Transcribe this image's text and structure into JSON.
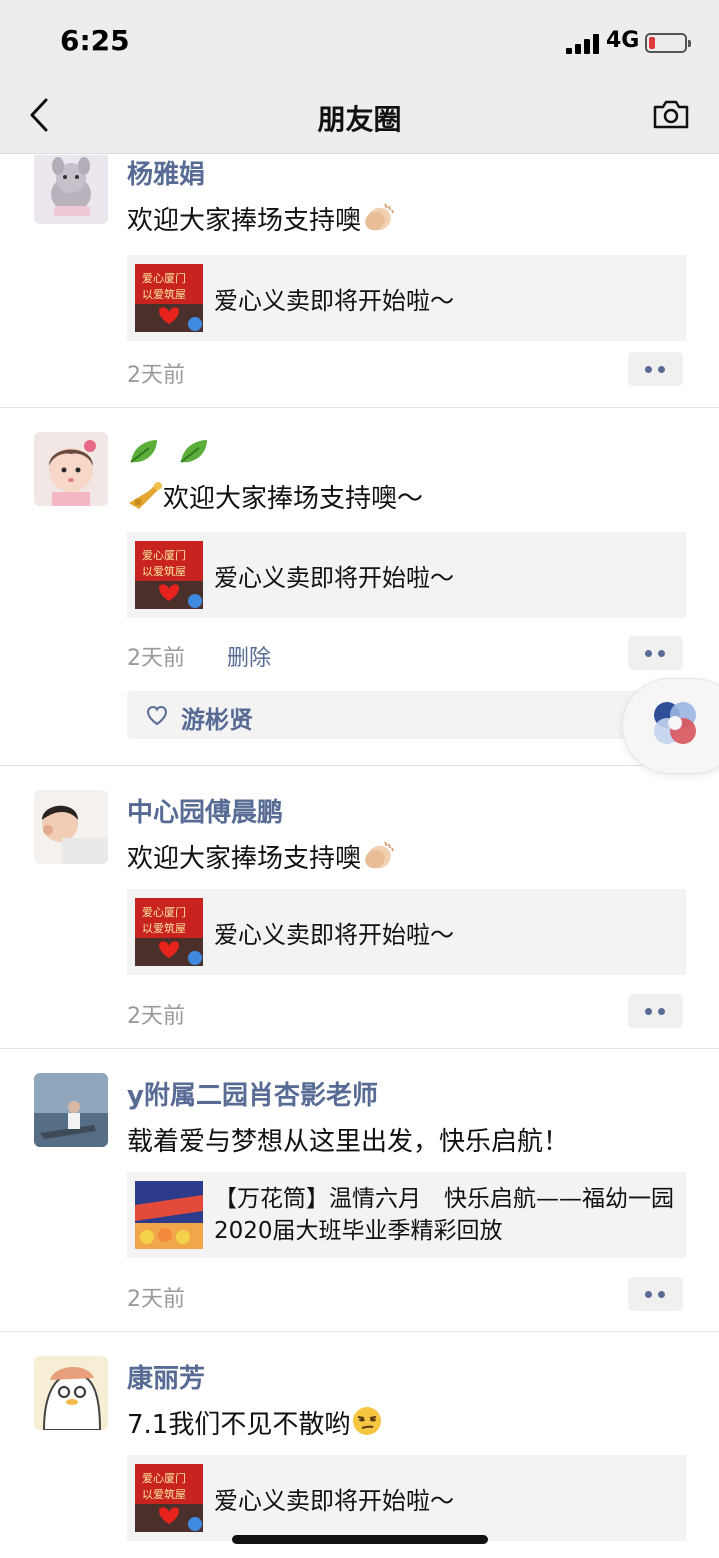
{
  "status_bar": {
    "time": "6:25",
    "network": "4G"
  },
  "nav": {
    "title": "朋友圈",
    "back_icon": "chevron-left-icon",
    "camera_icon": "camera-icon"
  },
  "posts": [
    {
      "author": "杨雅娟",
      "text": "欢迎大家捧场支持噢",
      "text_emoji": "clapping-hands-emoji",
      "card": {
        "title": "爱心义卖即将开始啦～",
        "thumb_text": "爱心厦门 以爱筑屋"
      },
      "time": "2天前"
    },
    {
      "emoji_line": "leaf-emoji leaf-emoji",
      "text": "欢迎大家捧场支持噢～",
      "text_emoji": "trumpet-emoji",
      "card": {
        "title": "爱心义卖即将开始啦～",
        "thumb_text": "爱心厦门 以爱筑屋"
      },
      "time": "2天前",
      "delete_label": "删除",
      "liker": "游彬贤"
    },
    {
      "author": "中心园傅晨鹏",
      "text": "欢迎大家捧场支持噢",
      "text_emoji": "clapping-hands-emoji",
      "card": {
        "title": "爱心义卖即将开始啦～",
        "thumb_text": "爱心厦门 以爱筑屋"
      },
      "time": "2天前"
    },
    {
      "author": "y附属二园肖杏影老师",
      "text": "载着爱与梦想从这里出发，快乐启航！",
      "card": {
        "title": "【万花筒】温情六月　快乐启航——福幼一园2020届大班毕业季精彩回放"
      },
      "time": "2天前"
    },
    {
      "author": "康丽芳",
      "text": "7.1我们不见不散哟",
      "text_emoji": "smirk-emoji",
      "card": {
        "title": "爱心义卖即将开始啦～",
        "thumb_text": "爱心厦门 以爱筑屋"
      }
    }
  ],
  "colors": {
    "nickname": "#576b95",
    "nav_bg": "#ededed",
    "card_bg": "#f3f3f3"
  }
}
